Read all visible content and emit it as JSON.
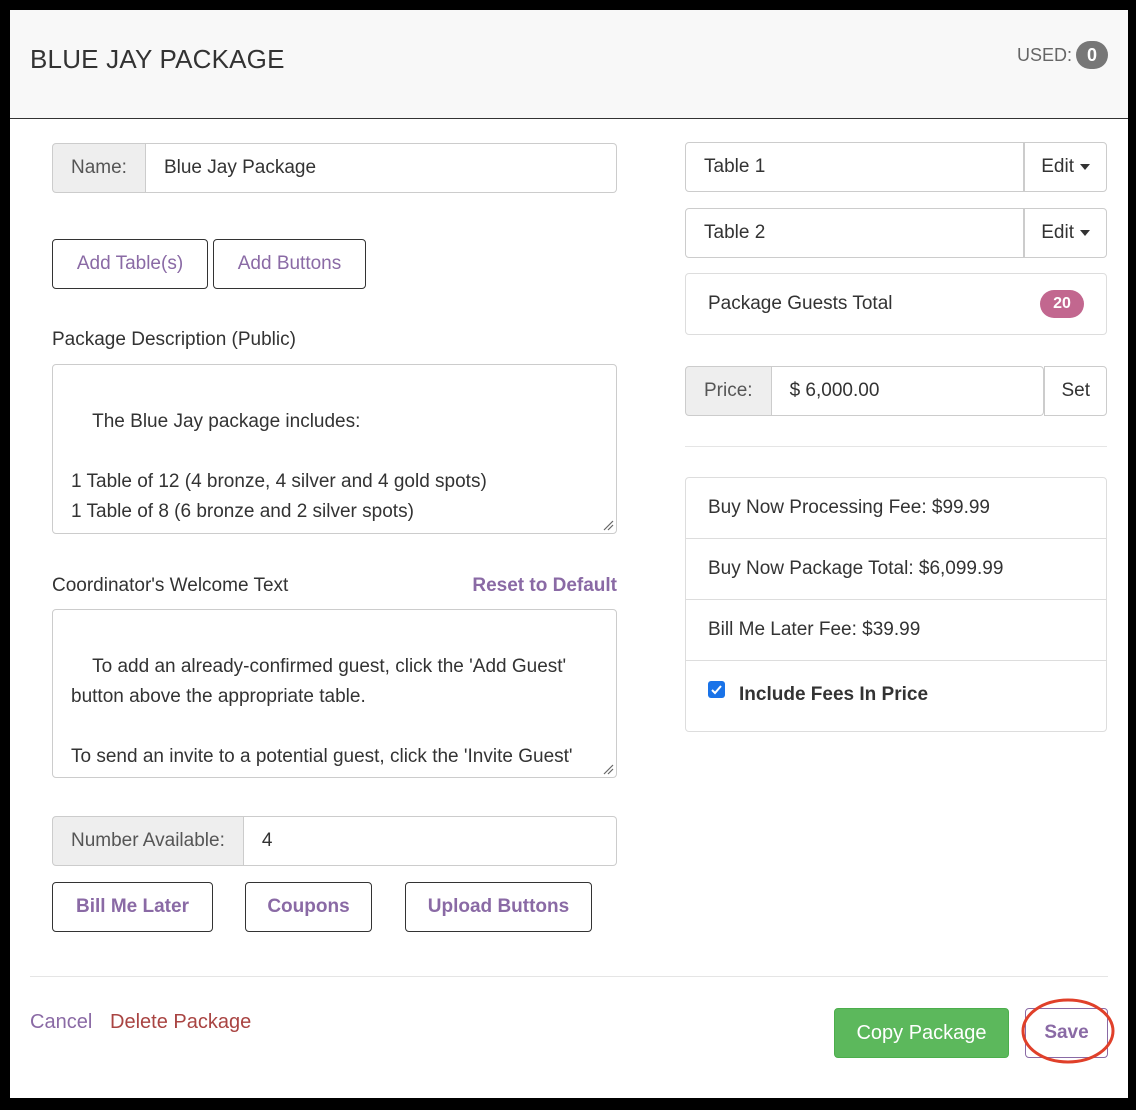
{
  "header": {
    "title": "BLUE JAY PACKAGE",
    "used_label": "USED:",
    "used_count": "0"
  },
  "form": {
    "name_label": "Name:",
    "name_value": "Blue Jay Package",
    "add_tables_label": "Add Table(s)",
    "add_buttons_label": "Add Buttons",
    "description_label": "Package Description (Public)",
    "description_text": "The Blue Jay package includes:\n\n1 Table of 12 (4 bronze, 4 silver and 4 gold spots)\n1 Table of 8 (6 bronze and 2 silver spots)",
    "welcome_label": "Coordinator's Welcome Text",
    "reset_label": "Reset to Default",
    "welcome_text": "To add an already-confirmed guest, click the 'Add Guest' button above the appropriate table.\n\nTo send an invite to a potential guest, click the 'Invite Guest' button above the appropriate table. The guest will receive an invite email for you to certain a request to",
    "number_label": "Number Available:",
    "number_value": "4",
    "bill_me_later_label": "Bill Me Later",
    "coupons_label": "Coupons",
    "upload_buttons_label": "Upload Buttons"
  },
  "tables": [
    {
      "name": "Table 1",
      "edit_label": "Edit"
    },
    {
      "name": "Table 2",
      "edit_label": "Edit"
    }
  ],
  "guests": {
    "label": "Package Guests Total",
    "count": "20"
  },
  "price": {
    "label": "Price:",
    "value": "$ 6,000.00",
    "set_label": "Set"
  },
  "fees": {
    "processing_fee": "Buy Now Processing Fee: $99.99",
    "package_total": "Buy Now Package Total: $6,099.99",
    "bill_later_fee": "Bill Me Later Fee: $39.99",
    "include_fees_label": "Include Fees In Price",
    "include_fees_checked": true
  },
  "footer": {
    "cancel_label": "Cancel",
    "delete_label": "Delete Package",
    "copy_label": "Copy Package",
    "save_label": "Save"
  },
  "colors": {
    "accent_purple": "#8a6aa5",
    "danger_red": "#a94442",
    "success_green": "#5cb85c",
    "badge_pink": "#c2678f",
    "highlight_circle": "#e0402a"
  }
}
